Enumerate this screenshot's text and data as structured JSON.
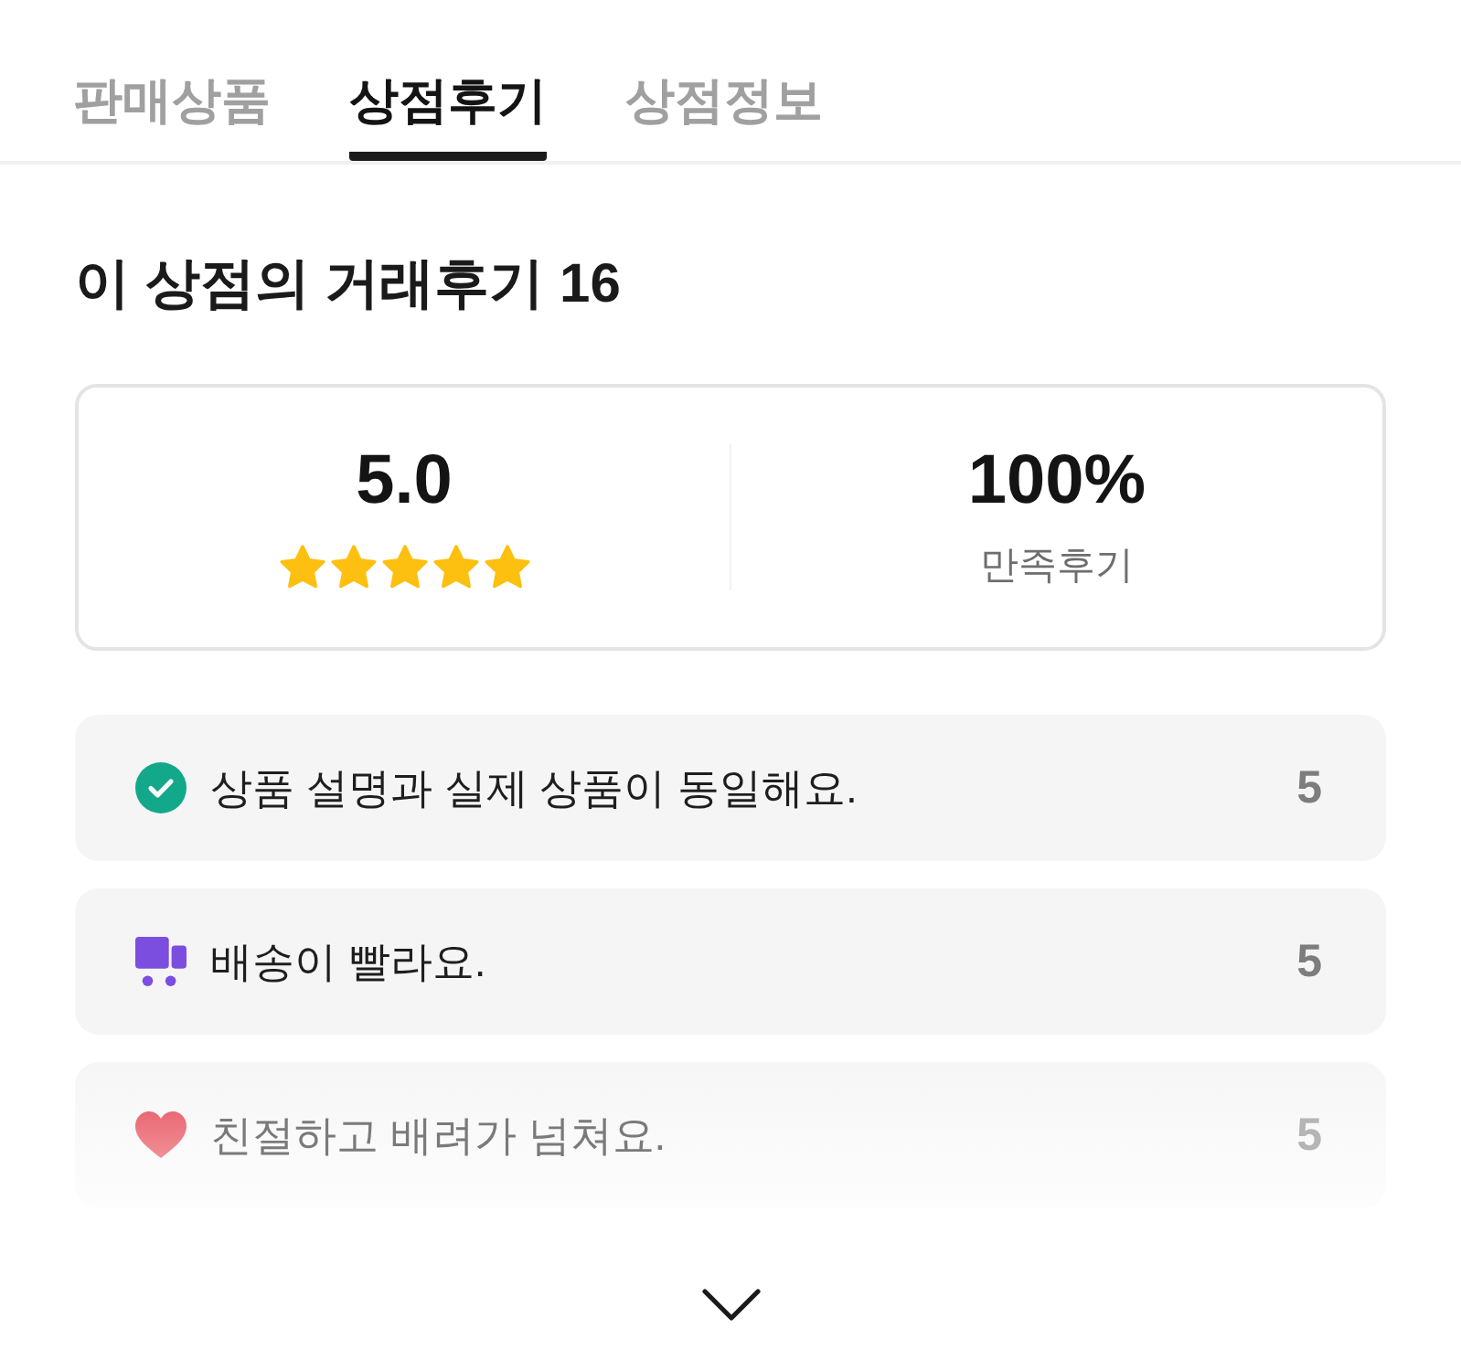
{
  "tabs": [
    {
      "label": "판매상품",
      "selected": false
    },
    {
      "label": "상점후기",
      "selected": true
    },
    {
      "label": "상점정보",
      "selected": false
    }
  ],
  "heading": "이 상점의 거래후기 16",
  "summary": {
    "rating": "5.0",
    "stars": 5,
    "satisfaction": "100%",
    "satisfaction_label": "만족후기"
  },
  "review_list": {
    "expanded": false,
    "items": [
      {
        "kind": "check",
        "label": "상품 설명과 실제 상품이 동일해요.",
        "count": "5"
      },
      {
        "kind": "truck",
        "label": "배송이 빨라요.",
        "count": "5"
      },
      {
        "kind": "heart",
        "label": "친절하고 배려가 넘쳐요.",
        "count": "5"
      }
    ]
  }
}
